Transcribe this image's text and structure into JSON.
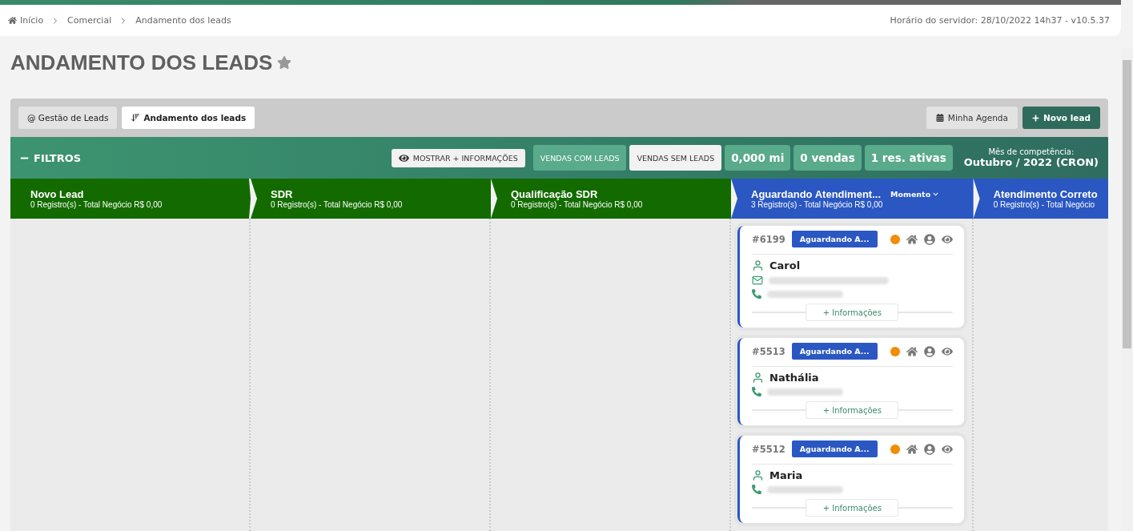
{
  "breadcrumb": [
    {
      "label": "Início",
      "kind": "home"
    },
    {
      "label": "Comercial",
      "kind": "link"
    },
    {
      "label": "Andamento dos leads",
      "kind": "link"
    }
  ],
  "server_info": "Horário do servidor: 28/10/2022 14h37 - v10.5.37",
  "title": "ANDAMENTO DOS LEADS",
  "favorite": false,
  "tabs": [
    {
      "label": "@ Gestão de Leads",
      "kind": "plain",
      "selected": false
    },
    {
      "label": "Andamento dos leads",
      "kind": "sorted",
      "selected": true
    }
  ],
  "actions": [
    {
      "label": "Minha Agenda",
      "kind": "calendar"
    },
    {
      "label": "Novo lead",
      "kind": "add"
    }
  ],
  "filters": {
    "title": "FILTROS",
    "expanded": true,
    "info_button": "MOSTRAR + INFORMAÇÕES",
    "modes": [
      {
        "label": "VENDAS COM LEADS",
        "selected": false
      },
      {
        "label": "VENDAS SEM LEADS",
        "selected": true
      }
    ],
    "stats": [
      "0,000 mi",
      "0 vendas",
      "1 res. ativas"
    ],
    "period_label": "Mês de competência:",
    "period": "Outubro / 2022 (CRON)"
  },
  "stages": [
    {
      "name": "Novo Lead",
      "summary": "0 Registro(s) - Total Negócio R$ 0,00",
      "color": "#136b00"
    },
    {
      "name": "SDR",
      "summary": "0 Registro(s) - Total Negócio R$ 0,00",
      "color": "#136b00"
    },
    {
      "name": "Qualificação SDR",
      "summary": "0 Registro(s) - Total Negócio R$ 0,00",
      "color": "#136b00"
    },
    {
      "name": "Aguardando Atendiment...",
      "sort": "Momento",
      "summary": "3 Registro(s) - Total Negócio R$ 0,00",
      "color": "#2a57c2",
      "cards": [
        {
          "id": "#6199",
          "status": "Aguardando A...",
          "color": "#f28c00",
          "name": "Carol",
          "contacts": [
            {
              "kind": "email"
            },
            {
              "kind": "phone"
            }
          ],
          "more": "+ Informações"
        },
        {
          "id": "#5513",
          "status": "Aguardando A...",
          "color": "#f28c00",
          "name": "Nathália",
          "contacts": [
            {
              "kind": "phone"
            }
          ],
          "more": "+ Informações"
        },
        {
          "id": "#5512",
          "status": "Aguardando A...",
          "color": "#f28c00",
          "name": "Maria",
          "contacts": [
            {
              "kind": "phone"
            }
          ],
          "more": "+ Informações"
        }
      ]
    },
    {
      "name": "Atendimento Correto",
      "summary": "0 Registro(s) - Total Negócio",
      "color": "#2a57c2"
    }
  ]
}
